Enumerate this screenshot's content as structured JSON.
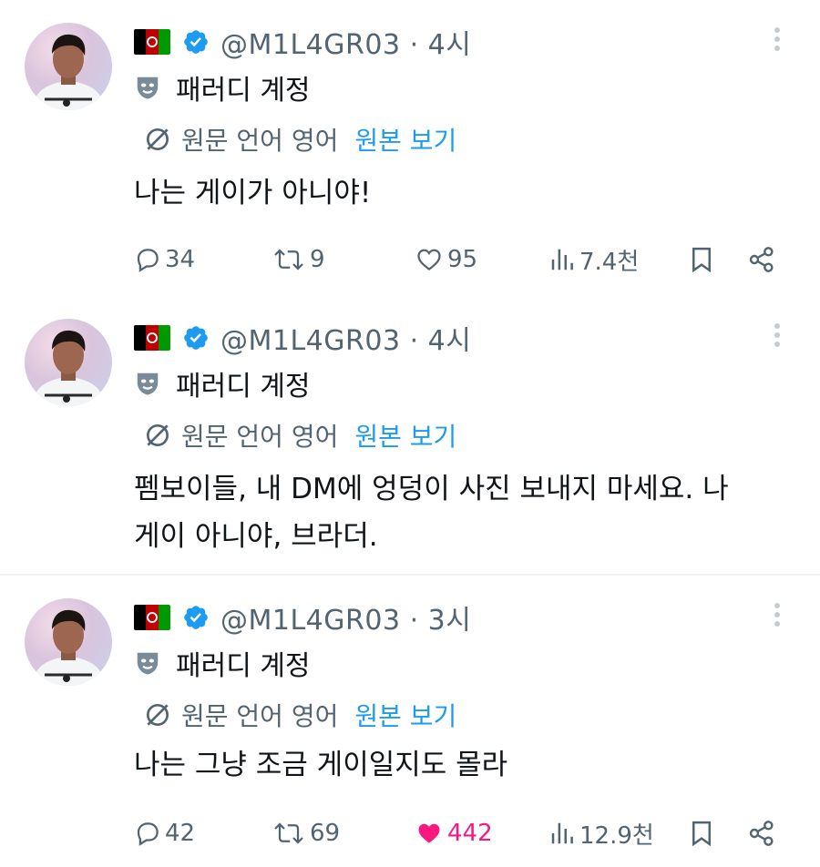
{
  "tweets": [
    {
      "handle": "@M1L4GR03",
      "time": "· 4시",
      "parody_label": "패러디 계정",
      "translate_lang": "원문 언어 영어",
      "translate_link": "원본 보기",
      "text": "나는 게이가 아니야!",
      "replies": "34",
      "reposts": "9",
      "likes": "95",
      "views": "7.4천",
      "liked": false
    },
    {
      "handle": "@M1L4GR03",
      "time": "· 4시",
      "parody_label": "패러디 계정",
      "translate_lang": "원문 언어 영어",
      "translate_link": "원본 보기",
      "text_line1": "펨보이들, 내 DM에 엉덩이 사진 보내지 마세요. 나",
      "text_line2": "게이 아니야, 브라더."
    },
    {
      "handle": "@M1L4GR03",
      "time": "· 3시",
      "parody_label": "패러디 계정",
      "translate_lang": "원문 언어 영어",
      "translate_link": "원본 보기",
      "text": "나는 그냥 조금 게이일지도 몰라",
      "replies": "42",
      "reposts": "69",
      "likes": "442",
      "views": "12.9천",
      "liked": true
    }
  ],
  "colors": {
    "text": "#0f1419",
    "muted": "#536471",
    "link": "#1d9bf0",
    "like_active": "#f91880",
    "divider": "#eff3f4"
  },
  "icons": {
    "flag": "afghanistan-flag-icon",
    "verified": "verified-badge-icon",
    "parody": "parody-mask-icon",
    "translate": "translate-globe-icon",
    "reply": "reply-icon",
    "repost": "repost-icon",
    "like": "heart-icon",
    "views": "views-icon",
    "bookmark": "bookmark-icon",
    "share": "share-icon",
    "more": "more-options-icon"
  }
}
